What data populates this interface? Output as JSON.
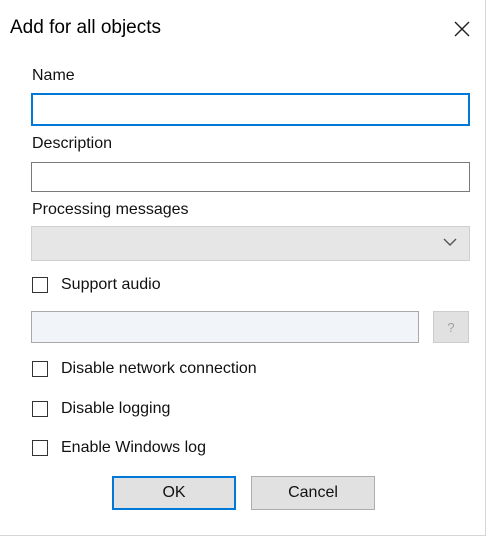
{
  "window": {
    "title": "Add for all objects",
    "close_icon": "close-icon"
  },
  "fields": {
    "name_label": "Name",
    "name_value": "",
    "description_label": "Description",
    "description_value": "",
    "processing_label": "Processing messages",
    "processing_value": ""
  },
  "checkboxes": {
    "support_audio": {
      "label": "Support audio",
      "checked": false
    },
    "disable_network": {
      "label": "Disable network connection",
      "checked": false
    },
    "disable_logging": {
      "label": "Disable logging",
      "checked": false
    },
    "enable_windows_log": {
      "label": "Enable Windows log",
      "checked": false
    }
  },
  "audio": {
    "path_value": "",
    "help_label": "?"
  },
  "buttons": {
    "ok_label": "OK",
    "cancel_label": "Cancel"
  },
  "colors": {
    "focus": "#0078d7",
    "disabled_bg": "#e6e6e6",
    "button_bg": "#e1e1e1"
  }
}
